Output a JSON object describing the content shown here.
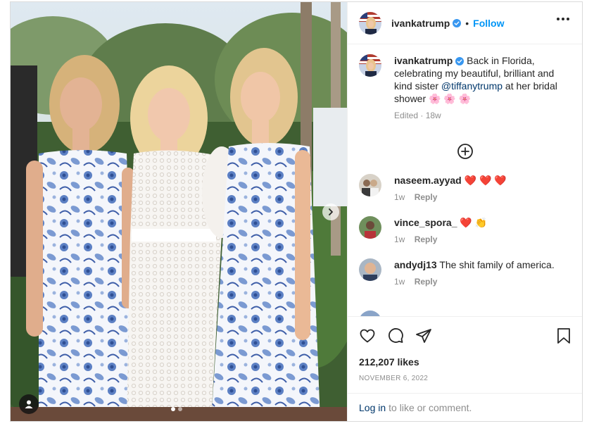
{
  "post": {
    "username": "ivankatrump",
    "follow_label": "Follow",
    "separator": "•",
    "caption_text_before": "Back in Florida, celebrating my beautiful, brilliant and kind sister ",
    "caption_mention": "@tiffanytrump",
    "caption_text_after": " at her bridal shower ",
    "caption_emoji": "🌸 🌸 🌸",
    "caption_meta": "Edited · 18w",
    "likes": "212,207 likes",
    "date": "NOVEMBER 6, 2022",
    "login_link": "Log in",
    "login_rest": "to like or comment."
  },
  "comments": [
    {
      "username": "naseem.ayyad",
      "text": "",
      "emoji": "❤️ ❤️ ❤️",
      "time": "1w",
      "reply": "Reply"
    },
    {
      "username": "vince_spora_",
      "text": "",
      "emoji": "❤️ 👏",
      "time": "1w",
      "reply": "Reply"
    },
    {
      "username": "andydj13",
      "text": "The shit family of america.",
      "emoji": "",
      "time": "1w",
      "reply": "Reply"
    }
  ],
  "colors": {
    "accent": "#0095f6",
    "verified": "#3897f0",
    "text": "#262626",
    "muted": "#8e8e8e",
    "border": "#dbdbdb",
    "mention": "#00376b"
  },
  "icons": [
    "verified-badge-icon",
    "more-options-icon",
    "load-more-comments-icon",
    "heart-icon",
    "comment-icon",
    "share-icon",
    "save-icon",
    "next-arrow-icon",
    "tagged-user-icon"
  ],
  "carousel": {
    "slides": 2,
    "active": 1
  }
}
